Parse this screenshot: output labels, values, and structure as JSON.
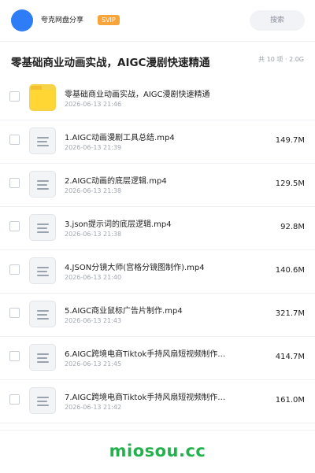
{
  "header": {
    "app_name": "夸克网盘分享",
    "badge": "SVIP",
    "search_placeholder": "搜索",
    "accent": "#2e7cf6",
    "badge_color": "#f7a43a"
  },
  "share": {
    "title": "零基础商业动画实战，AIGC漫剧快速精通",
    "meta": "共 10 项 · 2.0G"
  },
  "items": [
    {
      "type": "folder",
      "name": "零基础商业动画实战，AIGC漫剧快速精通",
      "date": "2026-06-13 21:46",
      "size": ""
    },
    {
      "type": "file",
      "name": "1.AIGC动画漫剧工具总结.mp4",
      "date": "2026-06-13 21:39",
      "size": "149.7M"
    },
    {
      "type": "file",
      "name": "2.AIGC动画的底层逻辑.mp4",
      "date": "2026-06-13 21:38",
      "size": "129.5M"
    },
    {
      "type": "file",
      "name": "3.json提示词的底层逻辑.mp4",
      "date": "2026-06-13 21:38",
      "size": "92.8M"
    },
    {
      "type": "file",
      "name": "4.JSON分镜大师(宫格分镜图制作).mp4",
      "date": "2026-06-13 21:40",
      "size": "140.6M"
    },
    {
      "type": "file",
      "name": "5.AIGC商业鼠标广告片制作.mp4",
      "date": "2026-06-13 21:43",
      "size": "321.7M"
    },
    {
      "type": "file",
      "name": "6.AIGC跨境电商Tiktok手持风扇短视频制作…",
      "date": "2026-06-13 21:45",
      "size": "414.7M"
    },
    {
      "type": "file",
      "name": "7.AIGC跨境电商Tiktok手持风扇短视频制作…",
      "date": "2026-06-13 21:42",
      "size": "161.0M"
    }
  ],
  "footer": {
    "brand": "miosou.cc",
    "brand_color": "#23b14d"
  }
}
